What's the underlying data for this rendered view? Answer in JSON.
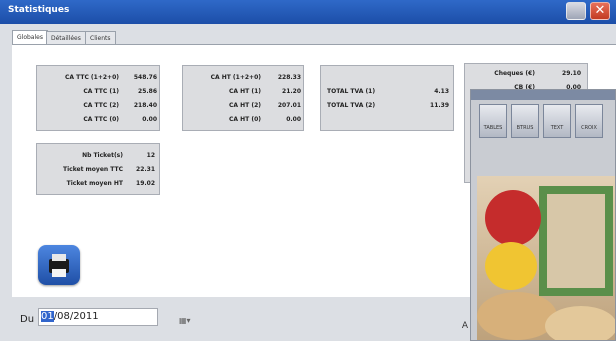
{
  "window": {
    "title": "Statistiques"
  },
  "tabs": [
    "Globales",
    "Détaillées",
    "Clients"
  ],
  "box1": {
    "rows": [
      {
        "label": "CA TTC (1+2+0)",
        "value": "548.76"
      },
      {
        "label": "CA TTC (1)",
        "value": "25.86"
      },
      {
        "label": "CA TTC (2)",
        "value": "218.40"
      },
      {
        "label": "CA TTC (0)",
        "value": "0.00"
      }
    ]
  },
  "box2": {
    "rows": [
      {
        "label": "CA HT (1+2+0)",
        "value": "228.33"
      },
      {
        "label": "CA HT (1)",
        "value": "21.20"
      },
      {
        "label": "CA HT (2)",
        "value": "207.01"
      },
      {
        "label": "CA HT (0)",
        "value": "0.00"
      }
    ]
  },
  "box3": {
    "rows": [
      {
        "label": "TOTAL TVA (1)",
        "value": "4.13"
      },
      {
        "label": "TOTAL TVA (2)",
        "value": "11.39"
      }
    ]
  },
  "box4": {
    "rows": [
      {
        "label": "Cheques (€)",
        "value": "29.10"
      },
      {
        "label": "CB (€)",
        "value": "0.00"
      }
    ]
  },
  "box5": {
    "rows": [
      {
        "label": "Nb Ticket(s)",
        "value": "12"
      },
      {
        "label": "Ticket moyen TTC",
        "value": "22.31"
      },
      {
        "label": "Ticket moyen HT",
        "value": "19.02"
      }
    ]
  },
  "footer": {
    "du_label": "Du",
    "date_day": "01",
    "date_rest": "/08/2011",
    "truncated_right": "A"
  },
  "overlay": {
    "tools": [
      "TABLES",
      "BTRUS",
      "TEXT",
      "CROIX"
    ]
  },
  "colors": {
    "titlebar": "#1c4ea8",
    "panel": "#ffffff",
    "box": "#dcdde0",
    "selection": "#3266cc"
  }
}
